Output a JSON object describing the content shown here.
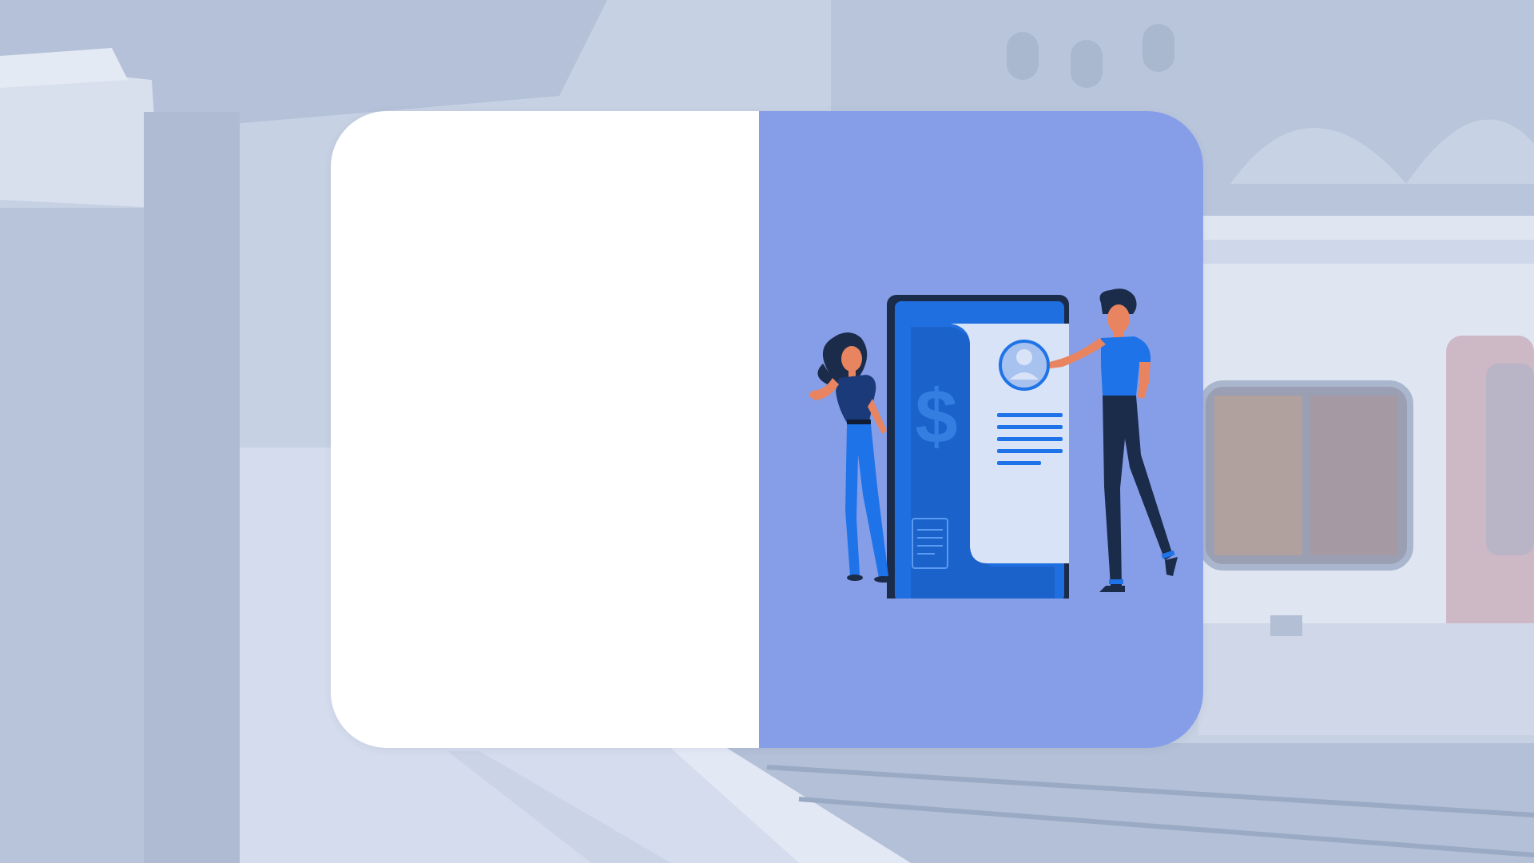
{
  "colors": {
    "page_background": "#c5d0e2",
    "card_left": "#ffffff",
    "card_right": "#869ee8",
    "phone_frame": "#1b2b4a",
    "phone_screen": "#1f6fe0",
    "document": "#d8e3f7",
    "accent_blue": "#1e73e8",
    "skin": "#e8845f"
  },
  "background": {
    "scene": "subway-platform-photo",
    "overlay": "light-blue-tint"
  },
  "illustration": {
    "icons": [
      "phone-icon",
      "dollar-sign-icon",
      "profile-icon",
      "document-lines-icon",
      "woman-figure",
      "man-figure"
    ],
    "dollar_glyph": "$"
  }
}
